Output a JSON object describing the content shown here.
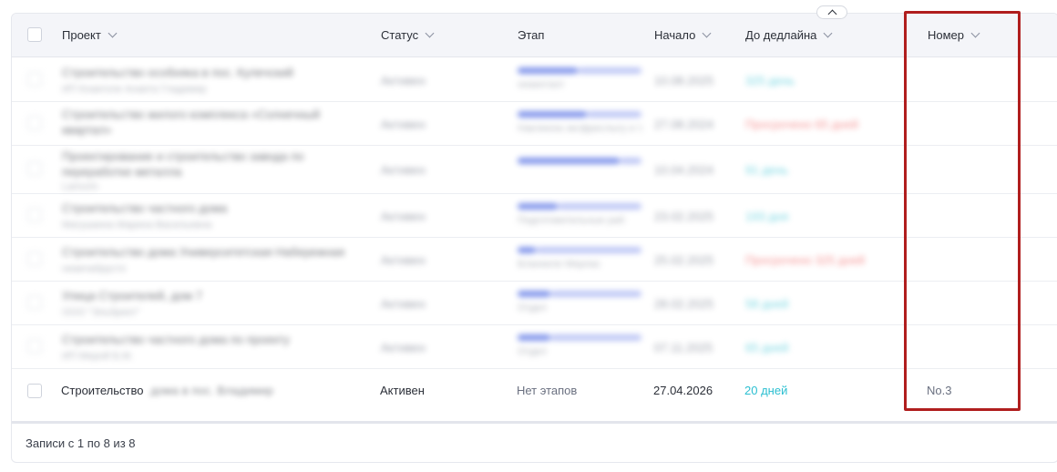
{
  "columns": {
    "project": "Проект",
    "status": "Статус",
    "stage": "Этап",
    "start": "Начало",
    "deadline": "До дедлайна",
    "number": "Номер"
  },
  "blurred_rows": [
    {
      "title": "Строительство особняка в пос. Кулечский",
      "subtitle": "ИП Кнаеголи Анаета Гладимир",
      "status": "Активен",
      "stage_sub": "ниаектаот",
      "start": "10.08.2025",
      "deadline": "325 день",
      "deadline_tone": "teal"
    },
    {
      "title": "Строительство жилого комплекса «Солнечный квартал»",
      "subtitle": "Наклиноа эксфреслыгу и т.",
      "status": "Активен",
      "stage_sub": "Наклиноа эксфреслыгу и т.",
      "start": "27.08.2024",
      "deadline": "Просрочено 65 дней",
      "deadline_tone": "red"
    },
    {
      "title": "Проектирование и строительство завода по переработке металла",
      "subtitle": "Lamurin",
      "status": "Активен",
      "stage_sub": "",
      "start": "10.04.2024",
      "deadline": "91 день",
      "deadline_tone": "teal"
    },
    {
      "title": "Строительство частного дома",
      "subtitle": "Магушкина Марина Васильевна",
      "status": "Активен",
      "stage_sub": "Подготовительные раб",
      "start": "23.02.2025",
      "deadline": "193 дня",
      "deadline_tone": "teal"
    },
    {
      "title": "Строительство дома Университетская Набережная",
      "subtitle": "ниаечабрусто",
      "status": "Активен",
      "stage_sub": "Бланкеле Мерлас",
      "start": "25.02.2025",
      "deadline": "Просрочено 325 дней",
      "deadline_tone": "red"
    },
    {
      "title": "Улица Строителей, дом 7",
      "subtitle": "ООО \"Эльбриот\"",
      "status": "Активен",
      "stage_sub": "Отдел",
      "start": "28.02.2025",
      "deadline": "58 дней",
      "deadline_tone": "teal"
    },
    {
      "title": "Строительство частного дома по проекту",
      "subtitle": "ИП Мерой Б.М.",
      "status": "Активен",
      "stage_sub": "Отдел",
      "start": "07.11.2025",
      "deadline": "65 дней",
      "deadline_tone": "teal"
    }
  ],
  "last_row": {
    "title_visible": "Строительство",
    "title_blurred": "дома в пос. Владимир",
    "status": "Активен",
    "stage": "Нет этапов",
    "start": "27.04.2026",
    "deadline": "20 дней",
    "number": "No.3"
  },
  "footer": {
    "records": "Записи с 1 по 8 из 8"
  },
  "colors": {
    "highlight": "#b01e1e",
    "teal": "#2bbfd1",
    "red": "#f05b5b"
  }
}
